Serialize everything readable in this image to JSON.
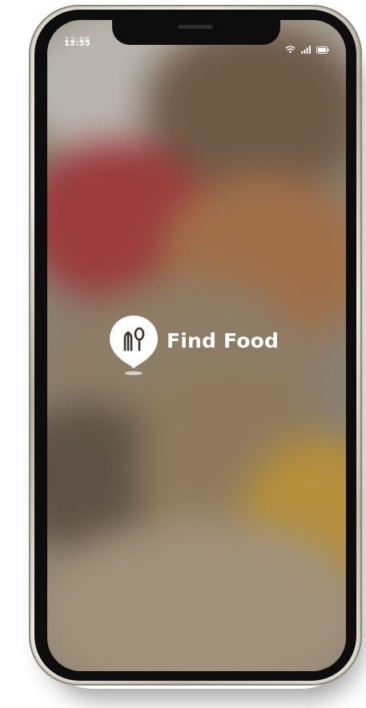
{
  "status_bar": {
    "time": "12:55",
    "wifi_icon": "wifi-icon",
    "signal_icon": "cellular-signal-icon",
    "battery_icon": "battery-icon"
  },
  "splash": {
    "logo_icon": "map-pin-fork-spoon-icon",
    "app_name": "Find Food"
  },
  "colors": {
    "logo": "#ffffff",
    "text": "#ffffff",
    "phone_bezel": "#0d0d0d",
    "background_tint": "#8a7f70"
  }
}
